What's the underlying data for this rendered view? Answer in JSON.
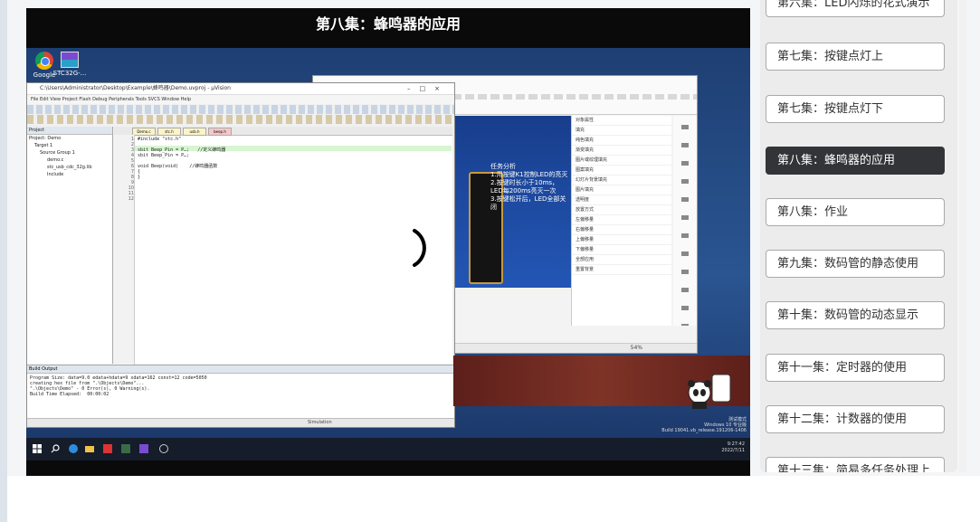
{
  "video": {
    "title": "第八集：蜂鸣器的应用",
    "desktop_icons": [
      {
        "label": "Google",
        "icon": "chrome-icon"
      },
      {
        "label": "STC32G-...",
        "icon": "stc-icon"
      }
    ],
    "ide": {
      "title": "C:\\Users\\Administrator\\Desktop\\Example\\蜂鸣器\\Demo.uvproj - µVision",
      "menu": "File  Edit  View  Project  Flash  Debug  Peripherals  Tools  SVCS  Window  Help",
      "project_header": "Project",
      "tree": [
        "Project: Demo",
        "Target 1",
        "Source Group 1",
        "demo.c",
        "stc_usb_cdc_32g.lib",
        "Include"
      ],
      "tabs": [
        "Demo.c",
        "stc.h",
        "usb.h",
        "beep.h"
      ],
      "code": "#include \"stc.h\"\n\nsbit Beep_Pin = P…;   //定义蜂鸣器\nsbit Beep_Pin = P…;\n\nvoid Beep(void)    //蜂鸣器函数\n{\n}",
      "build_header": "Build Output",
      "build_output": "Program Size: data=9.0 edata+hdata=9 xdata=162 const=12 code=5050\ncreating hex file from \".\\Objects\\Demo\"...\n\".\\Objects\\Demo\" - 0 Error(s), 0 Warning(s).\nBuild Time Elapsed:  00:00:02",
      "status": "Simulation"
    },
    "ppt": {
      "slide_text": "任务分析\n1.用按键K1控制LED的亮灭\n2.按键时长小于10ms，LED每200ms亮灭一次\n3.按键松开后，LED全部关闭",
      "panel_rows": [
        "对象属性",
        "填充",
        "纯色填充",
        "渐变填充",
        "图片或纹理填充",
        "图案填充",
        "幻灯片背景填充",
        "图片填充",
        "透明度",
        "放置方式",
        "左偏移量",
        "右偏移量",
        "上偏移量",
        "下偏移量",
        "全部应用",
        "重置背景"
      ],
      "zoom": "54%"
    },
    "watermark": "测试模式\nWindows 10 专业版\nBuild 19041.vb_release.191206-1406",
    "clock": "9:27:42\n2022/7/11"
  },
  "playlist": {
    "items": [
      {
        "label": "第六集：LED闪烁的花式演示",
        "active": false
      },
      {
        "label": "第七集：按键点灯上",
        "active": false
      },
      {
        "label": "第七集：按键点灯下",
        "active": false
      },
      {
        "label": "第八集：蜂鸣器的应用",
        "active": true
      },
      {
        "label": "第八集：作业",
        "active": false
      },
      {
        "label": "第九集：数码管的静态使用",
        "active": false
      },
      {
        "label": "第十集：数码管的动态显示",
        "active": false
      },
      {
        "label": "第十一集：定时器的使用",
        "active": false
      },
      {
        "label": "第十二集：计数器的使用",
        "active": false
      },
      {
        "label": "第十三集：简易多任务处理上",
        "active": false
      }
    ]
  },
  "colors": {
    "active_item_bg": "#333438",
    "player_bg": "#0a0a0a",
    "desktop_blue": "#2a5591"
  }
}
